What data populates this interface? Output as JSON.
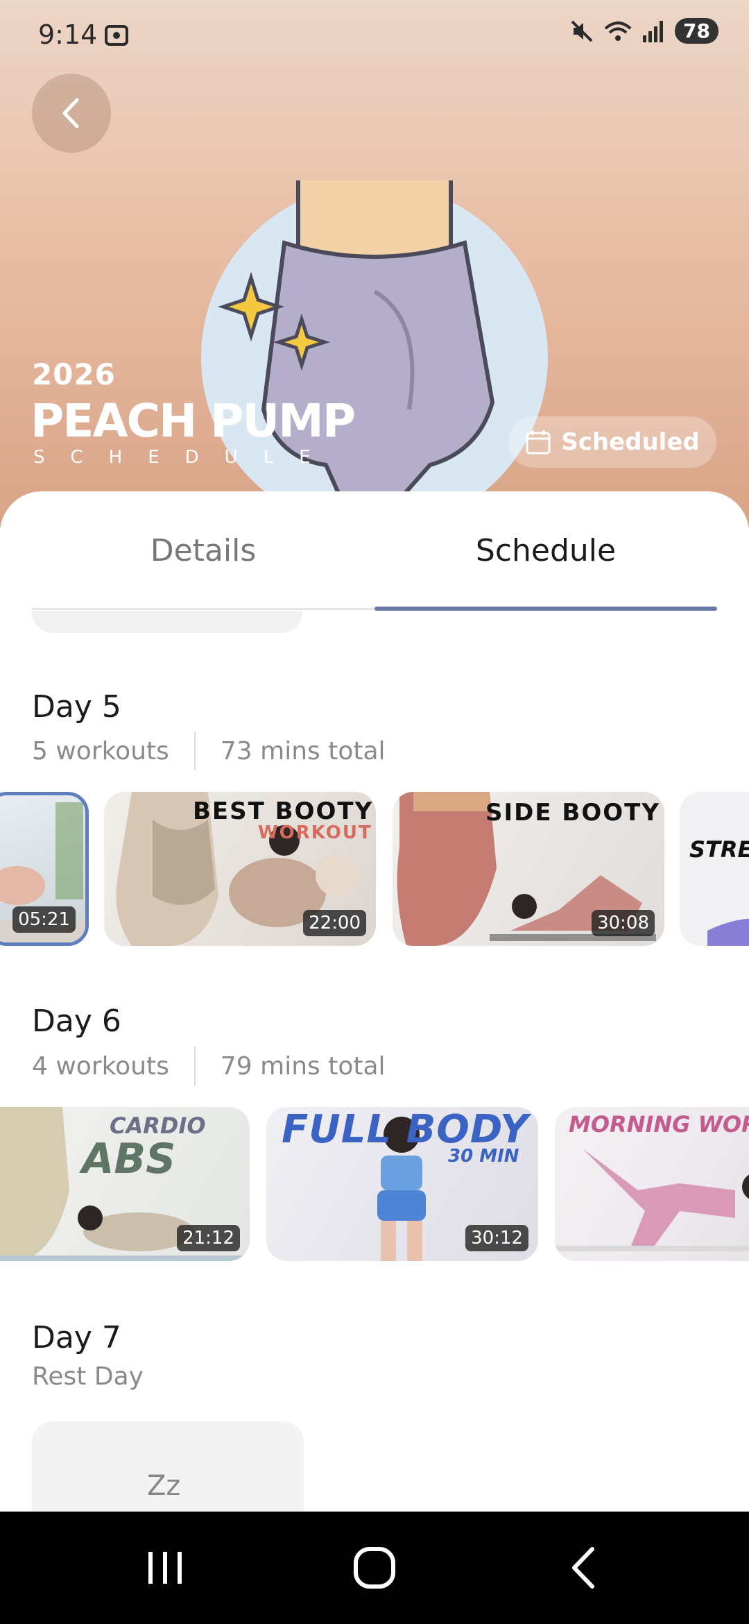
{
  "status_bar": {
    "time": "9:14",
    "signal_icon": "signal-icon",
    "wifi_badge": "6",
    "battery": "78"
  },
  "header": {
    "year": "2026",
    "title": "PEACH PUMP",
    "subtitle": "SCHEDULE",
    "scheduled_label": "Scheduled"
  },
  "tabs": [
    {
      "label": "Details",
      "active": false
    },
    {
      "label": "Schedule",
      "active": true
    }
  ],
  "days": [
    {
      "title": "Day 5",
      "workouts": "5 workouts",
      "total": "73 mins total",
      "videos": [
        {
          "title": "",
          "duration": "05:21",
          "selected": true
        },
        {
          "title": "BEST BOOTY",
          "subtitle": "WORKOUT",
          "duration": "22:00"
        },
        {
          "title": "SIDE BOOTY",
          "duration": "30:08"
        },
        {
          "title": "STRE",
          "duration": ""
        }
      ]
    },
    {
      "title": "Day 6",
      "workouts": "4 workouts",
      "total": "79 mins total",
      "videos": [
        {
          "title": "CARDIO",
          "subtitle": "ABS",
          "duration": "21:12"
        },
        {
          "title": "FULL BODY",
          "subtitle": "30 MIN",
          "duration": "30:12"
        },
        {
          "title": "MORNING WOR",
          "duration": ""
        }
      ]
    },
    {
      "title": "Day 7",
      "rest_label": "Rest Day",
      "rest_icon": "Zz"
    }
  ],
  "colors": {
    "accent": "#6a78a9",
    "hero_top": "#ecd6c8",
    "hero_bottom": "#d9a386"
  }
}
